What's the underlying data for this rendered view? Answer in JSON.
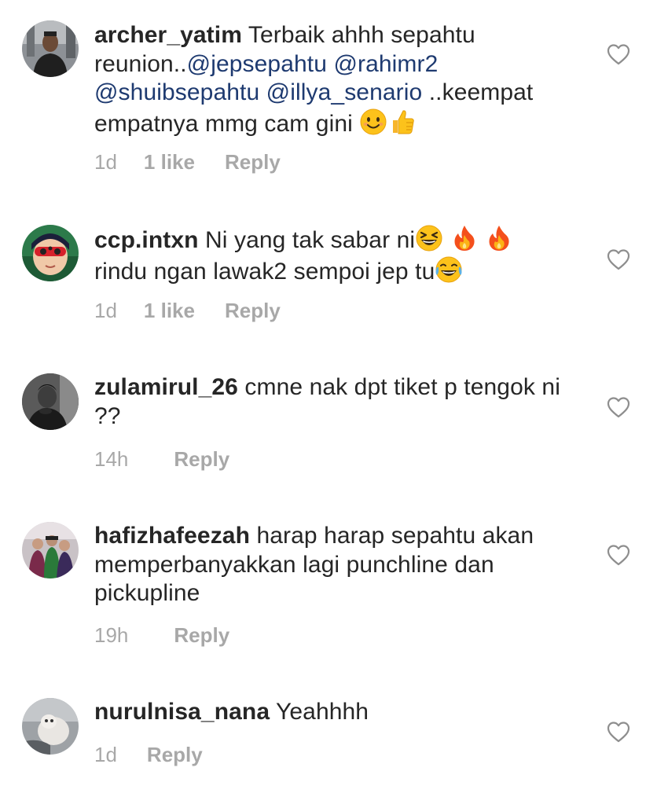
{
  "comments": [
    {
      "username": "archer_yatim",
      "text_1": " Terbaik ahhh sepahtu reunion..",
      "mention_1": "@jepsepahtu",
      "mention_2": "@rahimr2",
      "mention_3": "@shuibsepahtu",
      "mention_4": "@illya_senario",
      "text_2": " ..keempat empatnya mmg cam gini ",
      "emojis": [
        "smiling-face-emoji",
        "thumbs-up-emoji"
      ],
      "time": "1d",
      "likes": "1 like",
      "reply": "Reply"
    },
    {
      "username": "ccp.intxn",
      "text_1": " Ni yang tak sabar ni",
      "text_2": "rindu ngan lawak2 sempoi jep tu",
      "emojis": [
        "grinning-squinting-emoji",
        "fire-emoji",
        "fire-emoji",
        "tears-of-joy-emoji"
      ],
      "time": "1d",
      "likes": "1 like",
      "reply": "Reply"
    },
    {
      "username": "zulamirul_26",
      "text": " cmne nak dpt tiket p tengok ni ??",
      "time": "14h",
      "reply": "Reply"
    },
    {
      "username": "hafizhafeezah",
      "text": " harap harap sepahtu akan memperbanyakkan lagi punchline dan pickupline",
      "time": "19h",
      "reply": "Reply"
    },
    {
      "username": "nurulnisa_nana",
      "text": " Yeahhhh",
      "time": "1d",
      "reply": "Reply"
    }
  ],
  "colors": {
    "text": "#262626",
    "mention": "#1e3a70",
    "meta": "#a8a8a8",
    "heart_outline": "#8e8e8e"
  }
}
